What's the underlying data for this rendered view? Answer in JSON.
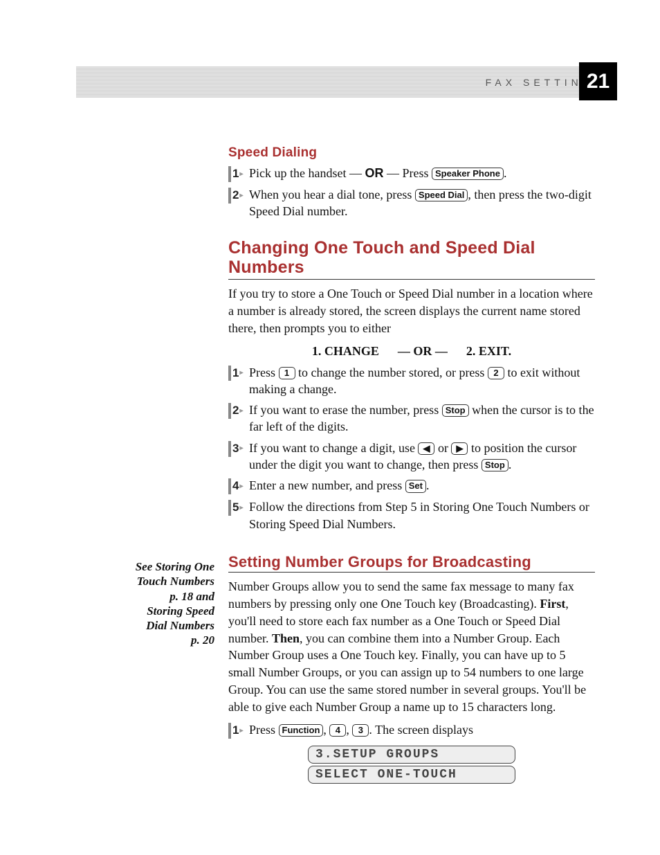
{
  "header": {
    "section": "FAX SETTINGS",
    "page_number": "21"
  },
  "sidebar": {
    "text": "See Storing One Touch Numbers p. 18 and Storing Speed Dial Numbers p. 20"
  },
  "section1": {
    "heading": "Speed Dialing",
    "step1": {
      "pre": "Pick up the handset — ",
      "or": "OR",
      "post": " — Press ",
      "key": "Speaker Phone",
      "end": "."
    },
    "step2": {
      "pre": "When you hear a dial tone, press ",
      "key": "Speed Dial",
      "post": ", then press the two-digit Speed Dial number."
    }
  },
  "section2": {
    "heading": "Changing One Touch and Speed Dial Numbers",
    "intro": "If you try to store a One Touch or Speed Dial number in a location where a number is already stored, the screen displays the current name stored there, then prompts you to either",
    "choice": {
      "opt1": "1. CHANGE",
      "sep": "— OR —",
      "opt2": "2. EXIT."
    },
    "step1": {
      "pre": "Press ",
      "key1": "1",
      "mid": " to change the number stored, or press ",
      "key2": "2",
      "post": " to exit without making a change."
    },
    "step2": {
      "pre": "If you want to erase the number, press ",
      "key": "Stop",
      "post": " when the cursor is to the far left of the digits."
    },
    "step3": {
      "pre": "If you want to change a digit, use ",
      "key1": "◀",
      "mid1": " or ",
      "key2": "▶",
      "mid2": " to position the cursor under the digit you want to change, then press ",
      "key3": "Stop",
      "post": "."
    },
    "step4": {
      "pre": "Enter a new number, and press ",
      "key": "Set",
      "post": "."
    },
    "step5": "Follow the directions from Step 5 in Storing One Touch Numbers or Storing Speed Dial Numbers."
  },
  "section3": {
    "heading": "Setting Number Groups for Broadcasting",
    "intro_a": "Number Groups allow you to send the same fax message to many fax numbers by pressing only one One Touch key (Broadcasting). ",
    "first": "First",
    "intro_b": ", you'll need to store each fax number as a One Touch or Speed Dial number. ",
    "then": "Then",
    "intro_c": ", you can combine them into a Number Group. Each Number Group uses a One Touch key. Finally, you can have up to 5 small Number Groups, or you can assign up to 54 numbers to one large Group. You can use the same stored number in several groups. You'll be able to give each Number Group a name up to 15 characters long.",
    "step1": {
      "pre": "Press ",
      "key1": "Function",
      "sep1": ", ",
      "key2": "4",
      "sep2": ", ",
      "key3": "3",
      "post": ".  The screen displays"
    },
    "lcd1": "3.SETUP GROUPS",
    "lcd2": "SELECT ONE-TOUCH"
  }
}
